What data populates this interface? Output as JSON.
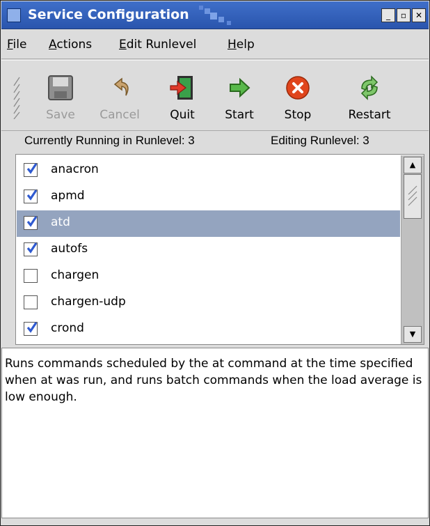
{
  "window": {
    "title": "Service Configuration",
    "controls": [
      "minimize",
      "maximize",
      "close"
    ]
  },
  "menu": {
    "file": {
      "mnemonic": "F",
      "rest": "ile"
    },
    "actions": {
      "mnemonic": "A",
      "rest": "ctions"
    },
    "edit_runlevel": {
      "mnemonic": "E",
      "rest": "dit Runlevel"
    },
    "help": {
      "mnemonic": "H",
      "rest": "elp"
    }
  },
  "toolbar": {
    "save": {
      "label": "Save",
      "icon": "floppy-disk-icon",
      "enabled": false
    },
    "cancel": {
      "label": "Cancel",
      "icon": "undo-arrow-icon",
      "enabled": false
    },
    "quit": {
      "label": "Quit",
      "icon": "exit-door-icon",
      "enabled": true
    },
    "start": {
      "label": "Start",
      "icon": "right-arrow-icon",
      "enabled": true
    },
    "stop": {
      "label": "Stop",
      "icon": "stop-x-icon",
      "enabled": true
    },
    "restart": {
      "label": "Restart",
      "icon": "recycle-arrows-icon",
      "enabled": true
    }
  },
  "status": {
    "running": "Currently Running in Runlevel: 3",
    "editing": "Editing Runlevel: 3"
  },
  "services": [
    {
      "name": "anacron",
      "checked": true,
      "selected": false
    },
    {
      "name": "apmd",
      "checked": true,
      "selected": false
    },
    {
      "name": "atd",
      "checked": true,
      "selected": true
    },
    {
      "name": "autofs",
      "checked": true,
      "selected": false
    },
    {
      "name": "chargen",
      "checked": false,
      "selected": false
    },
    {
      "name": "chargen-udp",
      "checked": false,
      "selected": false
    },
    {
      "name": "crond",
      "checked": true,
      "selected": false
    }
  ],
  "description": "Runs commands scheduled by the at command at the time specified when at was run, and runs batch commands when the load average is low enough.",
  "colors": {
    "titlebar": "#2a55ad",
    "selection": "#94a4bf",
    "checkmark": "#2f5ad0",
    "stop_red": "#e0451c",
    "start_green": "#3a9a2a"
  }
}
